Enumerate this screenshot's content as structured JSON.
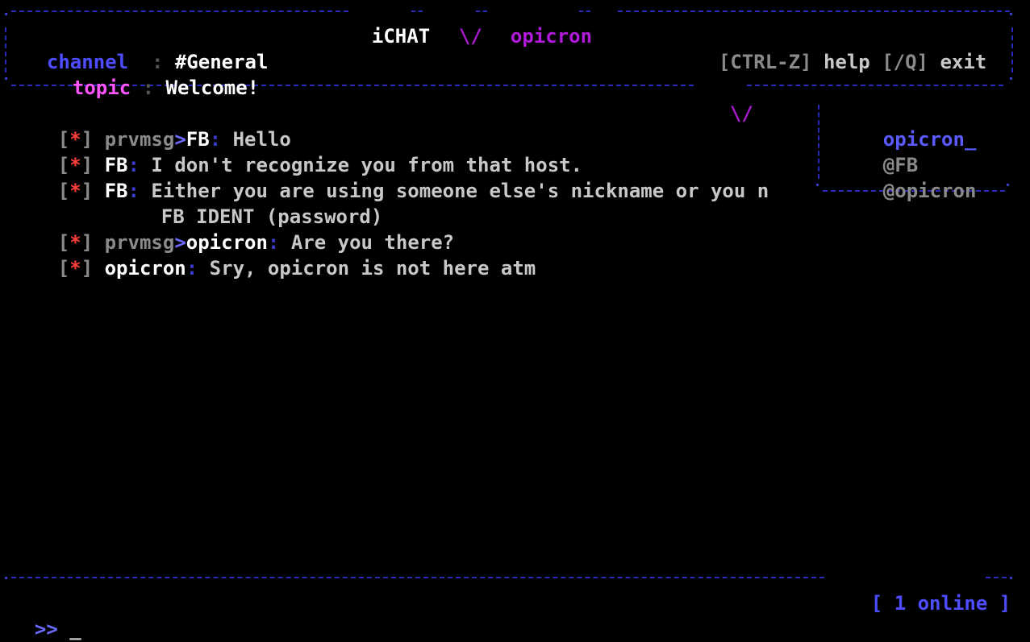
{
  "header": {
    "app_title": "iCHAT",
    "sep": "\\/",
    "user": "opicron",
    "channel_label": "channel",
    "channel_value": "#General",
    "topic_label": "topic",
    "topic_value": "Welcome!",
    "help_key": "[CTRL-Z]",
    "help_label": "help",
    "exit_key": "[/Q]",
    "exit_label": "exit",
    "divider_glyph": "\\/"
  },
  "messages": [
    {
      "marker": "*",
      "prefix": "prvmsg",
      "arrow": ">",
      "nick": "FB",
      "text": "Hello",
      "cont": ""
    },
    {
      "marker": "*",
      "prefix": "",
      "arrow": "",
      "nick": "FB",
      "text": "I don't recognize you from that host.",
      "cont": ""
    },
    {
      "marker": "*",
      "prefix": "",
      "arrow": "",
      "nick": "FB",
      "text": "Either you are using someone else's nickname or you n",
      "cont": "FB IDENT (password)"
    },
    {
      "marker": "*",
      "prefix": "prvmsg",
      "arrow": ">",
      "nick": "opicron",
      "text": "Are you there?",
      "cont": ""
    },
    {
      "marker": "*",
      "prefix": "",
      "arrow": "",
      "nick": "opicron",
      "text": "Sry, opicron is not here atm",
      "cont": ""
    }
  ],
  "userlist": {
    "self": "opicron_",
    "users": [
      "@FB",
      "@opicron"
    ]
  },
  "status": {
    "online": "[ 1 online ]"
  },
  "input": {
    "prompt": ">>",
    "cursor": "_"
  }
}
